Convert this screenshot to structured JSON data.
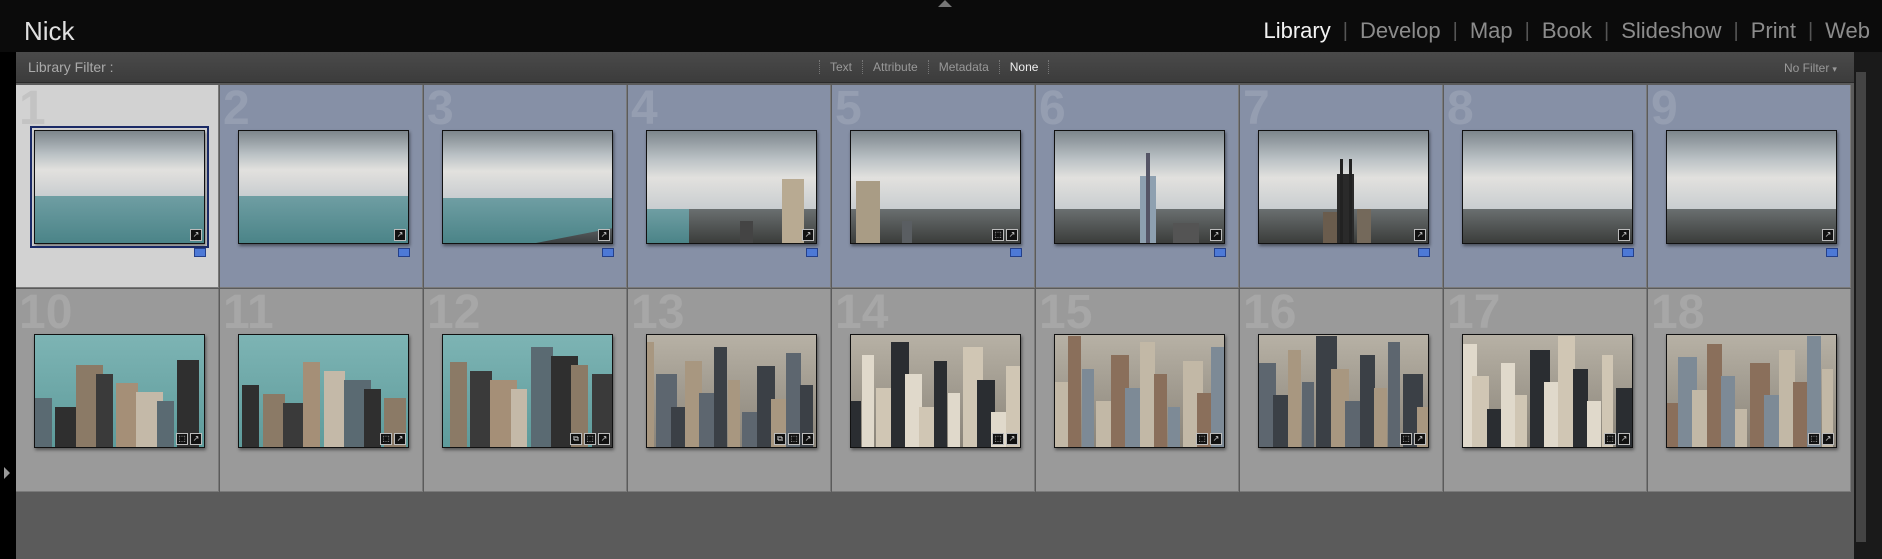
{
  "identity_plate": "Nick",
  "modules": [
    {
      "label": "Library",
      "active": true
    },
    {
      "label": "Develop",
      "active": false
    },
    {
      "label": "Map",
      "active": false
    },
    {
      "label": "Book",
      "active": false
    },
    {
      "label": "Slideshow",
      "active": false
    },
    {
      "label": "Print",
      "active": false
    },
    {
      "label": "Web",
      "active": false
    }
  ],
  "filter_bar": {
    "label": "Library Filter :",
    "tabs": [
      {
        "label": "Text",
        "active": false
      },
      {
        "label": "Attribute",
        "active": false
      },
      {
        "label": "Metadata",
        "active": false
      },
      {
        "label": "None",
        "active": true
      }
    ],
    "preset": "No Filter"
  },
  "grid": {
    "cells": [
      {
        "number": "1",
        "state": "current",
        "badges": 1,
        "flag": true,
        "scene": "lake"
      },
      {
        "number": "2",
        "state": "selected",
        "badges": 1,
        "flag": true,
        "scene": "lake"
      },
      {
        "number": "3",
        "state": "selected",
        "badges": 1,
        "flag": true,
        "scene": "shore"
      },
      {
        "number": "4",
        "state": "selected",
        "badges": 1,
        "flag": true,
        "scene": "tower-right"
      },
      {
        "number": "5",
        "state": "selected",
        "badges": 2,
        "flag": true,
        "scene": "tower-left"
      },
      {
        "number": "6",
        "state": "selected",
        "badges": 1,
        "flag": true,
        "scene": "spire"
      },
      {
        "number": "7",
        "state": "selected",
        "badges": 1,
        "flag": true,
        "scene": "willis"
      },
      {
        "number": "8",
        "state": "selected",
        "badges": 1,
        "flag": true,
        "scene": "plain"
      },
      {
        "number": "9",
        "state": "selected",
        "badges": 1,
        "flag": true,
        "scene": "plain"
      },
      {
        "number": "10",
        "state": "normal",
        "badges": 2,
        "flag": false,
        "scene": "harbor"
      },
      {
        "number": "11",
        "state": "normal",
        "badges": 2,
        "flag": false,
        "scene": "harbor"
      },
      {
        "number": "12",
        "state": "normal",
        "badges": 3,
        "flag": false,
        "scene": "harbor-city"
      },
      {
        "number": "13",
        "state": "normal",
        "badges": 3,
        "flag": false,
        "scene": "city"
      },
      {
        "number": "14",
        "state": "normal",
        "badges": 2,
        "flag": false,
        "scene": "city"
      },
      {
        "number": "15",
        "state": "normal",
        "badges": 2,
        "flag": false,
        "scene": "city"
      },
      {
        "number": "16",
        "state": "normal",
        "badges": 2,
        "flag": false,
        "scene": "city"
      },
      {
        "number": "17",
        "state": "normal",
        "badges": 2,
        "flag": false,
        "scene": "city"
      },
      {
        "number": "18",
        "state": "normal",
        "badges": 2,
        "flag": false,
        "scene": "city"
      }
    ]
  },
  "colors": {
    "selected_cell": "#8690a6",
    "current_cell": "#d2d2d2",
    "normal_cell": "#9a9a9a",
    "flag": "#4d79d6"
  },
  "icons": {
    "lock": "lock-icon",
    "badge": "develop-adjusted-icon",
    "flag": "selection-flag-icon"
  }
}
